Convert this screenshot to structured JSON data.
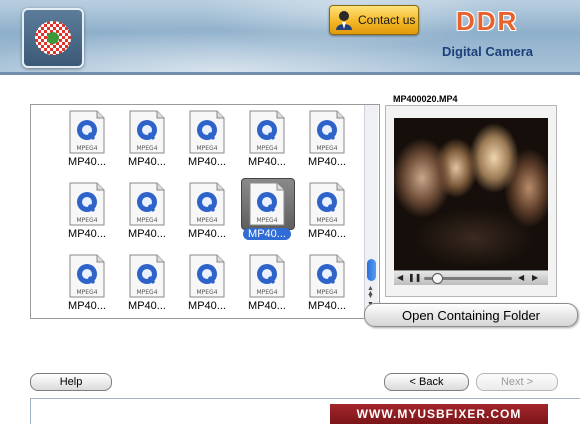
{
  "header": {
    "contact_label": "Contact us",
    "brand": "DDR",
    "product": "Digital Camera"
  },
  "files": {
    "icon_badge": "MPEG4",
    "items": [
      {
        "name": "MP40...",
        "selected": false
      },
      {
        "name": "MP40...",
        "selected": false
      },
      {
        "name": "MP40...",
        "selected": false
      },
      {
        "name": "MP40...",
        "selected": false
      },
      {
        "name": "MP40...",
        "selected": false
      },
      {
        "name": "MP40...",
        "selected": false
      },
      {
        "name": "MP40...",
        "selected": false
      },
      {
        "name": "MP40...",
        "selected": false
      },
      {
        "name": "MP40...",
        "selected": true
      },
      {
        "name": "MP40...",
        "selected": false
      },
      {
        "name": "MP40...",
        "selected": false
      },
      {
        "name": "MP40...",
        "selected": false
      },
      {
        "name": "MP40...",
        "selected": false
      },
      {
        "name": "MP40...",
        "selected": false
      },
      {
        "name": "MP40...",
        "selected": false
      }
    ]
  },
  "preview": {
    "title": "MP400020.MP4",
    "open_folder_label": "Open Containing Folder"
  },
  "footer": {
    "help_label": "Help",
    "back_label": "< Back",
    "next_label": "Next >",
    "url": "WWW.MYUSBFIXER.COM"
  },
  "colors": {
    "brand": "#e8612b",
    "product": "#1d3f7a",
    "selection": "#2f6cd6",
    "url_bar": "#8f1d22"
  }
}
